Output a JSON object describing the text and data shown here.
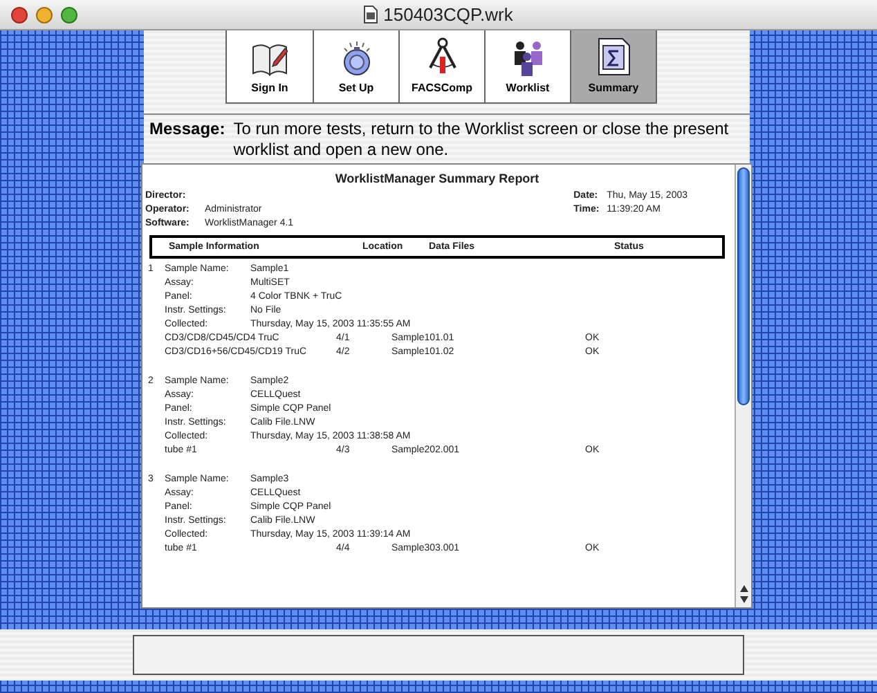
{
  "window": {
    "title": "150403CQP.wrk"
  },
  "toolbar": [
    {
      "label": "Sign In",
      "selected": false
    },
    {
      "label": "Set Up",
      "selected": false
    },
    {
      "label": "FACSComp",
      "selected": false
    },
    {
      "label": "Worklist",
      "selected": false
    },
    {
      "label": "Summary",
      "selected": true
    }
  ],
  "message": {
    "label": "Message:",
    "text": "To run more tests, return to the Worklist screen or close the present worklist and open a new one."
  },
  "report": {
    "title": "WorklistManager Summary Report",
    "info_left": [
      {
        "label": "Director:"
      },
      {
        "label": "Operator:",
        "value": "Administrator"
      },
      {
        "label": "Software:",
        "value": "WorklistManager  4.1"
      }
    ],
    "info_right": [
      {
        "label": "Date:",
        "value": "Thu, May 15, 2003"
      },
      {
        "label": "Time:",
        "value": "11:39:20 AM"
      }
    ],
    "columns": [
      "Sample Information",
      "Location",
      "Data Files",
      "Status"
    ],
    "samples": [
      {
        "number": "1",
        "fields": [
          {
            "label": "Sample Name:",
            "value": "Sample1"
          },
          {
            "label": "Assay:",
            "value": "MultiSET"
          },
          {
            "label": "Panel:",
            "value": "4 Color TBNK + TruC"
          },
          {
            "label": "Instr. Settings:",
            "value": "No File"
          },
          {
            "label": "Collected:",
            "value": "Thursday, May 15, 2003  11:35:55 AM"
          }
        ],
        "tubes": [
          {
            "name": "CD3/CD8/CD45/CD4 TruC",
            "location": "4/1",
            "file": "Sample101.01",
            "status": "OK"
          },
          {
            "name": "CD3/CD16+56/CD45/CD19 TruC",
            "location": "4/2",
            "file": "Sample101.02",
            "status": "OK"
          }
        ]
      },
      {
        "number": "2",
        "fields": [
          {
            "label": "Sample Name:",
            "value": "Sample2"
          },
          {
            "label": "Assay:",
            "value": "CELLQuest"
          },
          {
            "label": "Panel:",
            "value": "Simple CQP Panel"
          },
          {
            "label": "Instr. Settings:",
            "value": "Calib File.LNW"
          },
          {
            "label": "Collected:",
            "value": "Thursday, May 15, 2003  11:38:58 AM"
          }
        ],
        "tubes": [
          {
            "name": "tube #1",
            "location": "4/3",
            "file": "Sample202.001",
            "status": "OK"
          }
        ]
      },
      {
        "number": "3",
        "fields": [
          {
            "label": "Sample Name:",
            "value": "Sample3"
          },
          {
            "label": "Assay:",
            "value": "CELLQuest"
          },
          {
            "label": "Panel:",
            "value": "Simple CQP Panel"
          },
          {
            "label": "Instr. Settings:",
            "value": "Calib File.LNW"
          },
          {
            "label": "Collected:",
            "value": "Thursday, May 15, 2003  11:39:14 AM"
          }
        ],
        "tubes": [
          {
            "name": "tube #1",
            "location": "4/4",
            "file": "Sample303.001",
            "status": "OK"
          }
        ]
      }
    ]
  }
}
